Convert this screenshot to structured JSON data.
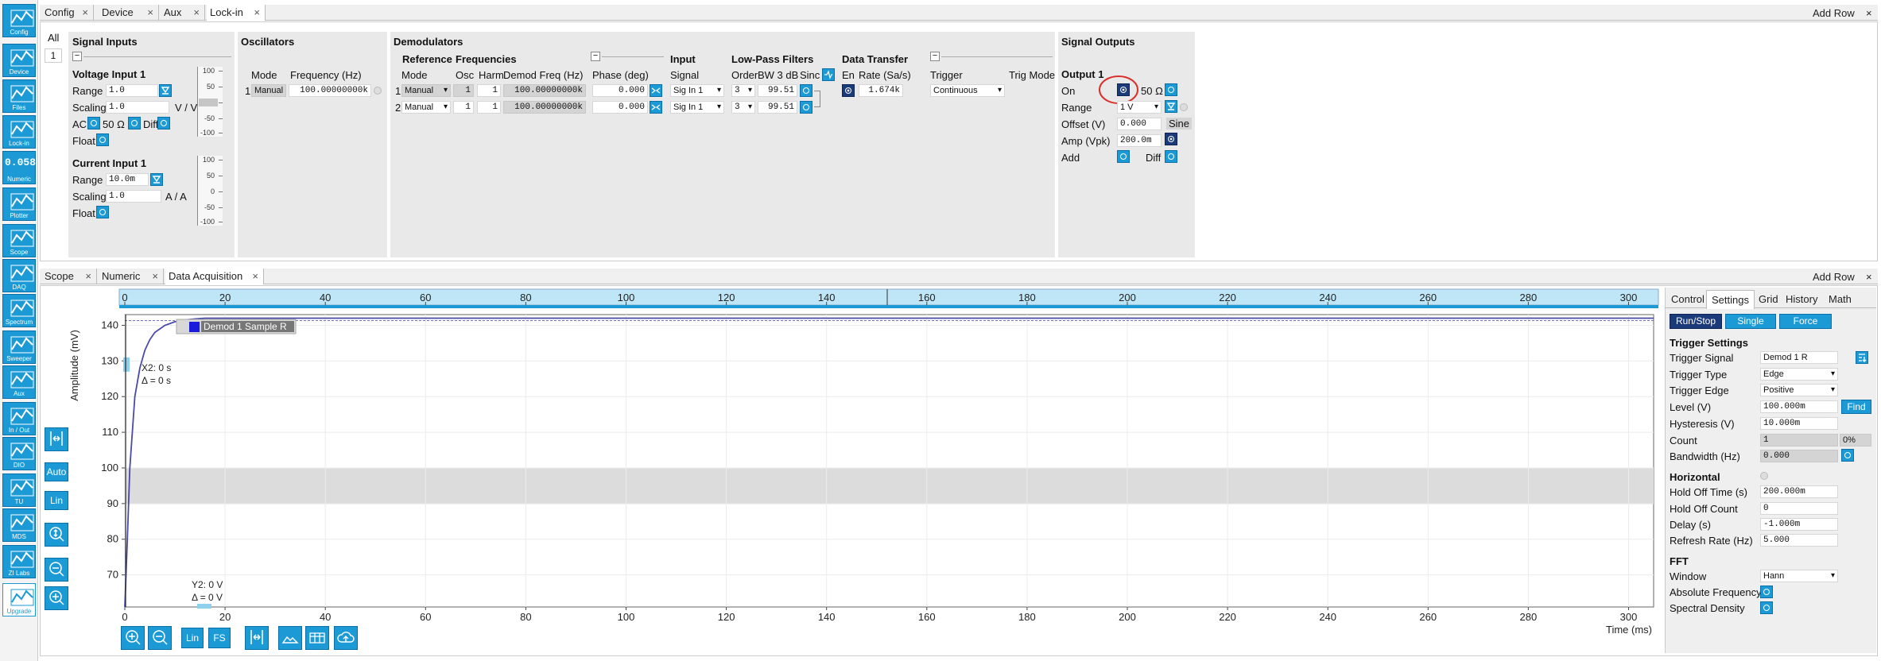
{
  "sidebar": [
    {
      "label": "Config",
      "icon": "gears-icon"
    },
    {
      "label": "Device",
      "icon": "device-icon"
    },
    {
      "label": "Files",
      "icon": "folder-icon"
    },
    {
      "label": "Lock-in",
      "icon": "lockin-icon"
    },
    {
      "label": "Numeric",
      "icon": "numeric-icon"
    },
    {
      "label": "Plotter",
      "icon": "plotter-icon"
    },
    {
      "label": "Scope",
      "icon": "scope-icon"
    },
    {
      "label": "DAQ",
      "icon": "daq-icon"
    },
    {
      "label": "Spectrum",
      "icon": "spectrum-icon"
    },
    {
      "label": "Sweeper",
      "icon": "sweeper-icon"
    },
    {
      "label": "Aux",
      "icon": "aux-icon"
    },
    {
      "label": "In / Out",
      "icon": "inout-icon"
    },
    {
      "label": "DIO",
      "icon": "dio-icon"
    },
    {
      "label": "TU",
      "icon": "tu-icon"
    },
    {
      "label": "MDS",
      "icon": "mds-icon"
    },
    {
      "label": "ZI Labs",
      "icon": "flask-icon"
    },
    {
      "label": "Upgrade",
      "icon": "upgrade-icon"
    }
  ],
  "numeric_icon_text": "0.058",
  "top_tabs": [
    "Config",
    "Device",
    "Aux",
    "Lock-in"
  ],
  "add_row": "Add Row",
  "top": {
    "all": "All",
    "row_index": "1",
    "collapse": "−",
    "signal_inputs": {
      "title": "Signal Inputs",
      "voltage_input": "Voltage Input 1",
      "range_label": "Range",
      "range_value": "1.0",
      "scaling_label": "Scaling",
      "scaling_value": "1.0",
      "scaling_unit": "V / V",
      "ac_label": "AC",
      "ohm_label": "50 Ω",
      "diff_label": "Diff",
      "float_label": "Float",
      "current_input": "Current Input 1",
      "c_range_value": "10.0m",
      "c_scaling_value": "1.0",
      "c_scaling_unit": "A / A",
      "meter_ticks": [
        "100",
        "50",
        "0",
        "-50",
        "-100"
      ]
    },
    "oscillators": {
      "title": "Oscillators",
      "mode_header": "Mode",
      "freq_header": "Frequency (Hz)",
      "row_index": "1",
      "mode_value": "Manual",
      "freq_value": "100.00000000k"
    },
    "demodulators": {
      "title": "Demodulators",
      "reference": "Reference",
      "frequencies": "Frequencies",
      "mode": "Mode",
      "osc": "Osc",
      "harm": "Harm",
      "demod_freq": "Demod Freq (Hz)",
      "phase": "Phase (deg)",
      "input": "Input",
      "signal": "Signal",
      "lpf": "Low-Pass Filters",
      "order": "Order",
      "bw": "BW 3 dB",
      "sinc": "Sinc",
      "data_transfer": "Data Transfer",
      "en": "En",
      "rate": "Rate (Sa/s)",
      "trigger": "Trigger",
      "trig_mode": "Trig Mode",
      "rows": [
        {
          "index": "1",
          "mode": "Manual",
          "osc": "1",
          "harm": "1",
          "freq": "100.00000000k",
          "phase": "0.000",
          "signal": "Sig In 1",
          "order": "3",
          "bw": "99.51",
          "rate": "1.674k",
          "trigger": "Continuous"
        },
        {
          "index": "2",
          "mode": "Manual",
          "osc": "1",
          "harm": "1",
          "freq": "100.00000000k",
          "phase": "0.000",
          "signal": "Sig In 1",
          "order": "3",
          "bw": "99.51"
        }
      ]
    },
    "signal_outputs": {
      "title": "Signal Outputs",
      "output": "Output 1",
      "on_label": "On",
      "ohm_label": "50 Ω",
      "range_label": "Range",
      "range_value": "1 V",
      "offset_label": "Offset (V)",
      "offset_value": "0.000",
      "sine_label": "Sine",
      "amp_label": "Amp (Vpk)",
      "amp_value": "200.0m",
      "add_label": "Add",
      "diff_label": "Diff"
    }
  },
  "bottom_tabs": [
    "Scope",
    "Numeric",
    "Data Acquisition"
  ],
  "plot": {
    "ylabel": "Amplitude (mV)",
    "xlabel": "Time (ms)",
    "legend": "Demod 1 Sample R",
    "legend_color": "#1a1adb",
    "curve_color": "#4a4aa8",
    "x_ticks": [
      "0",
      "20",
      "40",
      "60",
      "80",
      "100",
      "120",
      "140",
      "160",
      "180",
      "200",
      "220",
      "240",
      "260",
      "280",
      "300"
    ],
    "y_ticks": [
      "140",
      "130",
      "120",
      "110",
      "100",
      "90",
      "80",
      "70"
    ],
    "cursor_x_label": "X2: 0 s",
    "cursor_x_delta": "Δ = 0 s",
    "cursor_y_label": "Y2: 0 V",
    "cursor_y_delta": "Δ = 0 V",
    "auto_label": "Auto",
    "lin_label": "Lin",
    "fs_label": "FS"
  },
  "chart_data": {
    "type": "line",
    "xlabel": "Time (ms)",
    "ylabel": "Amplitude (mV)",
    "xlim": [
      0,
      305
    ],
    "ylim": [
      61,
      143
    ],
    "series": [
      {
        "name": "Demod 1 Sample R",
        "x": [
          0,
          0.5,
          1,
          2,
          3,
          4,
          5,
          6,
          8,
          10,
          12,
          14,
          16,
          20,
          25,
          30,
          40,
          60,
          100,
          150,
          200,
          250,
          305
        ],
        "y": [
          61,
          80,
          100,
          120,
          128,
          133,
          136,
          138,
          140,
          141,
          141.5,
          141.8,
          142,
          142,
          142,
          142,
          142,
          142,
          142,
          142,
          142,
          142,
          142
        ]
      }
    ]
  },
  "right_panel": {
    "tabs": [
      "Control",
      "Settings",
      "Grid",
      "History",
      "Math"
    ],
    "run_stop": "Run/Stop",
    "single": "Single",
    "force": "Force",
    "trigger_settings": "Trigger Settings",
    "trigger_signal_label": "Trigger Signal",
    "trigger_signal": "Demod 1 R",
    "trigger_type_label": "Trigger Type",
    "trigger_type": "Edge",
    "trigger_edge_label": "Trigger Edge",
    "trigger_edge": "Positive",
    "level_label": "Level (V)",
    "level": "100.000m",
    "find": "Find",
    "hysteresis_label": "Hysteresis (V)",
    "hysteresis": "10.000m",
    "count_label": "Count",
    "count": "1",
    "count_pct": "0%",
    "bandwidth_label": "Bandwidth (Hz)",
    "bandwidth": "0.000",
    "horizontal": "Horizontal",
    "hold_off_time_label": "Hold Off Time (s)",
    "hold_off_time": "200.000m",
    "hold_off_count_label": "Hold Off Count",
    "hold_off_count": "0",
    "delay_label": "Delay (s)",
    "delay": "-1.000m",
    "refresh_label": "Refresh Rate (Hz)",
    "refresh": "5.000",
    "fft": "FFT",
    "window_label": "Window",
    "window": "Hann",
    "abs_freq_label": "Absolute Frequency",
    "spectral_label": "Spectral Density"
  }
}
